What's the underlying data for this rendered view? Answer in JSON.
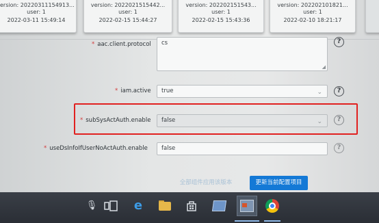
{
  "version_cards": [
    {
      "version": "/ersion: 20220311154913...",
      "user": "user: 1",
      "time": "2022-03-11 15:49:14"
    },
    {
      "version": "version: 2022021515442...",
      "user": "user: 1",
      "time": "2022-02-15 15:44:27"
    },
    {
      "version": "version: 202202151543...",
      "user": "user: 1",
      "time": "2022-02-15 15:43:36"
    },
    {
      "version": "version: 202202101821...",
      "user": "user: 1",
      "time": "2022-02-10 18:21:17"
    }
  ],
  "form": {
    "aac_client_protocol": {
      "label": "aac.client.protocol",
      "value": "cs"
    },
    "iam_active": {
      "label": "iam.active",
      "value": "true"
    },
    "sub_sys_act_auth_enable": {
      "label": "subSysActAuth.enable",
      "value": "false"
    },
    "use_ds_info_user_no_act_auth_enable": {
      "label": "useDsInfoIfUserNoActAuth.enable",
      "value": "false"
    }
  },
  "buttons": {
    "all_components_apply": "全部组件应用该版本",
    "update_current_config": "更新当前配置项目"
  },
  "icons": {
    "help": "?",
    "chevron": "⌄",
    "mic": "mic-icon",
    "task_view": "task-view-icon",
    "edge": "edge-icon",
    "folder": "folder-icon",
    "store": "store-icon",
    "app": "app-icon",
    "chrome": "chrome-icon"
  },
  "colors": {
    "highlight": "#e1201f",
    "primary_button": "#1479d6",
    "required_star": "#d23a3a"
  }
}
